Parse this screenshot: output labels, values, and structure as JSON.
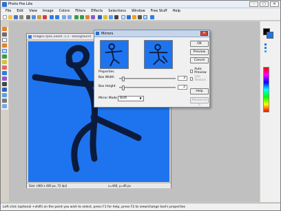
{
  "app": {
    "title": "Photo Pos Lite"
  },
  "window_buttons": [
    "–",
    "□",
    "✕"
  ],
  "menu": [
    "File",
    "Edit",
    "View",
    "Image",
    "Colors",
    "Filters",
    "Effects",
    "Selections",
    "Window",
    "Free Stuff",
    "Help"
  ],
  "document": {
    "title": "Image1.fpos   Zoom: 1:1 - Background",
    "status_left": "Size: (460 x 460 px, 72 dpi)",
    "status_right": "x=446, y=46 px"
  },
  "dialog": {
    "title": "Mirrors",
    "properties_label": "Properties",
    "box_width_label": "Box Width",
    "box_width_value": "3",
    "box_width_level": 0.05,
    "box_height_label": "Box Height",
    "box_height_value": "2",
    "box_height_level": 0.05,
    "mirror_mode_label": "Mirror Mode",
    "mirror_mode_value": "Both",
    "buttons": {
      "ok": "OK",
      "preview": "Preview",
      "cancel": "Cancel",
      "help": "Help",
      "advanced": "Advanced >"
    },
    "auto_preview": "Auto Preview",
    "use_texture": "Use Texture"
  },
  "statusbar": {
    "text": "Left click (optional +shift) on the point you wish to select, press F1 for help, press F2 to view/change tool's properties"
  },
  "colors": {
    "canvas_blue": "#1e74ee",
    "stroke_navy": "#0b1b3d"
  }
}
